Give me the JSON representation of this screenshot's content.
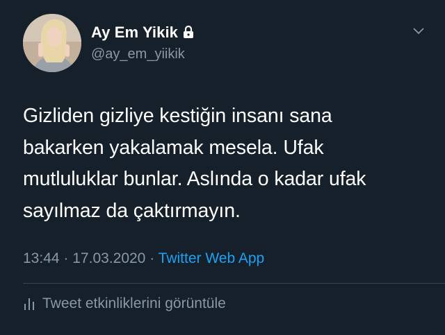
{
  "user": {
    "display_name": "Ay Em Yikik",
    "handle": "@ay_em_yiikik",
    "avatar_icon": "profile-photo",
    "protected_icon": "lock-icon"
  },
  "tweet": {
    "lines": [
      "Gizliden gizliye kestiğin insanı sana",
      "bakarken yakalamak mesela. Ufak",
      "mutluluklar bunlar. Aslında o kadar ufak",
      "sayılmaz da çaktırmayın."
    ],
    "time": "13:44",
    "separator": "·",
    "date": "17.03.2020",
    "source": "Twitter Web App"
  },
  "activity": {
    "label": "Tweet etkinliklerini görüntüle",
    "icon": "analytics-icon"
  },
  "colors": {
    "background": "#15202b",
    "secondary_text": "#8899a6",
    "link": "#1da1f2",
    "divider": "#38444d"
  }
}
